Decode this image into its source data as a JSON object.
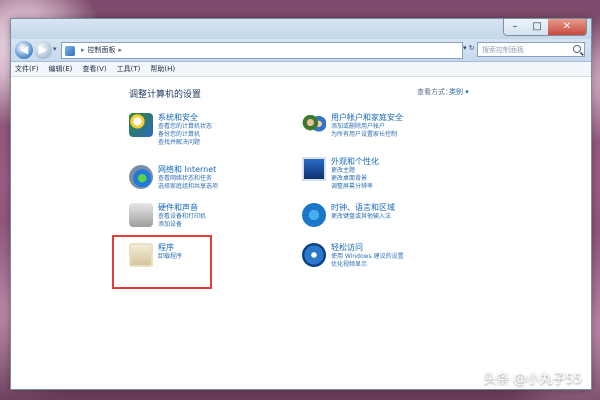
{
  "address_bar": {
    "breadcrumb_1": "控制面板",
    "breadcrumb_arrow": "▸",
    "search_placeholder": "搜索控制面板",
    "dropdown_arrow": "▾",
    "refresh": "↻"
  },
  "menu": [
    "文件(F)",
    "编辑(E)",
    "查看(V)",
    "工具(T)",
    "帮助(H)"
  ],
  "content": {
    "title": "调整计算机的设置",
    "view_by": "查看方式：",
    "view_mode": "类别 ▾"
  },
  "categories": [
    {
      "title": "系统和安全",
      "links": [
        "查看您的计算机状态",
        "备份您的计算机",
        "查找并解决问题"
      ]
    },
    {
      "title": "网络和 Internet",
      "links": [
        "查看网络状态和任务",
        "选择家庭组和共享选项"
      ]
    },
    {
      "title": "硬件和声音",
      "links": [
        "查看设备和打印机",
        "添加设备"
      ]
    },
    {
      "title": "程序",
      "links": [
        "卸载程序"
      ]
    },
    {
      "title": "用户帐户和家庭安全",
      "links": [
        "添加或删除用户帐户",
        "为所有用户设置家长控制"
      ]
    },
    {
      "title": "外观和个性化",
      "links": [
        "更改主题",
        "更改桌面背景",
        "调整屏幕分辨率"
      ]
    },
    {
      "title": "时钟、语言和区域",
      "links": [
        "更改键盘或其他输入法"
      ]
    },
    {
      "title": "轻松访问",
      "links": [
        "使用 Windows 建议的设置",
        "优化视频显示"
      ]
    }
  ],
  "window_buttons": {
    "minimize": "–",
    "maximize": "□",
    "close": "✕"
  },
  "nav": {
    "back": "◀",
    "forward": "▶",
    "down": "▾"
  },
  "watermark": "头条 @小丸子55"
}
